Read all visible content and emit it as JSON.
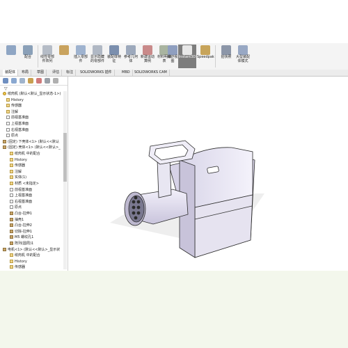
{
  "ribbon": {
    "buttons": [
      {
        "label": "",
        "icon": "assembly-icon"
      },
      {
        "label": "配合",
        "icon": "mate-icon"
      },
      {
        "label": "线性零部件阵列",
        "icon": "pattern-icon"
      },
      {
        "label": "",
        "icon": "smart-fastener-icon"
      },
      {
        "label": "插入零部件",
        "icon": "insert-component-icon"
      },
      {
        "label": "显示隐藏的零部件",
        "icon": "show-hidden-icon"
      },
      {
        "label": "装配体特征",
        "icon": "assembly-feature-icon"
      },
      {
        "label": "参考几何体",
        "icon": "reference-geometry-icon"
      },
      {
        "label": "新建运动算例",
        "icon": "motion-study-icon"
      },
      {
        "label": "材料明细表",
        "icon": "bom-icon"
      },
      {
        "label": "爆炸视图",
        "icon": "explode-icon"
      },
      {
        "label": "Instant3D",
        "icon": "instant3d-icon"
      },
      {
        "label": "Speedpak",
        "icon": "speedpak-icon"
      },
      {
        "label": "拍快照",
        "icon": "snapshot-icon"
      },
      {
        "label": "大型装配体模式",
        "icon": "large-assembly-icon"
      }
    ]
  },
  "tabs": [
    {
      "label": "装配体"
    },
    {
      "label": "布局"
    },
    {
      "label": "草图"
    },
    {
      "label": "评估"
    },
    {
      "label": "标注"
    },
    {
      "label": "SOLIDWORKS 插件"
    },
    {
      "label": "MBD"
    },
    {
      "label": "SOLIDWORKS CAM"
    }
  ],
  "tree": {
    "nodes": [
      {
        "label": "绞肉机 (默认<默认_显示状态-1>)",
        "type": "asm",
        "indent": 0
      },
      {
        "label": "History",
        "type": "fold",
        "indent": 1
      },
      {
        "label": "传感器",
        "type": "fold",
        "indent": 1
      },
      {
        "label": "注解",
        "type": "fold",
        "indent": 1
      },
      {
        "label": "前视基准面",
        "type": "pl",
        "indent": 1
      },
      {
        "label": "上视基准面",
        "type": "pl",
        "indent": 1
      },
      {
        "label": "右视基准面",
        "type": "pl",
        "indent": 1
      },
      {
        "label": "原点",
        "type": "pl",
        "indent": 1
      },
      {
        "label": "(固定) 下壳体<1> (默认<<默认",
        "type": "pt",
        "indent": 0
      },
      {
        "label": "(固定) 壳体<1> (默认<<默认>_",
        "type": "pt",
        "indent": 0
      },
      {
        "label": "绞肉机 中的配合",
        "type": "fold",
        "indent": 2
      },
      {
        "label": "History",
        "type": "fold",
        "indent": 2
      },
      {
        "label": "传感器",
        "type": "fold",
        "indent": 2
      },
      {
        "label": "注解",
        "type": "fold",
        "indent": 2
      },
      {
        "label": "实体(1)",
        "type": "fold",
        "indent": 2
      },
      {
        "label": "材质 <未指定>",
        "type": "fold",
        "indent": 2
      },
      {
        "label": "前视基准面",
        "type": "pl",
        "indent": 2
      },
      {
        "label": "上视基准面",
        "type": "pl",
        "indent": 2
      },
      {
        "label": "右视基准面",
        "type": "pl",
        "indent": 2
      },
      {
        "label": "原点",
        "type": "pl",
        "indent": 2
      },
      {
        "label": "凸台-拉伸1",
        "type": "pt",
        "indent": 2
      },
      {
        "label": "抽壳1",
        "type": "pt",
        "indent": 2
      },
      {
        "label": "凸台-拉伸2",
        "type": "pt",
        "indent": 2
      },
      {
        "label": "切除-拉伸1",
        "type": "pt",
        "indent": 2
      },
      {
        "label": "M5 螺纹孔1",
        "type": "pt",
        "indent": 2
      },
      {
        "label": "阵列(圆周)1",
        "type": "pt",
        "indent": 2
      },
      {
        "label": "电机<1> (默认<<默认>_显示状",
        "type": "pt",
        "indent": 0
      },
      {
        "label": "绞肉机 中的配合",
        "type": "fold",
        "indent": 2
      },
      {
        "label": "History",
        "type": "fold",
        "indent": 2
      },
      {
        "label": "传感器",
        "type": "fold",
        "indent": 2
      }
    ]
  }
}
